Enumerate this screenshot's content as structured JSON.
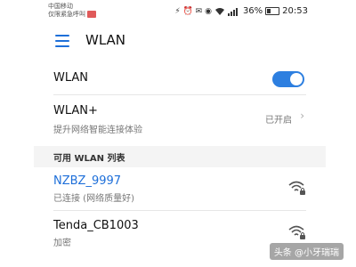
{
  "status_bar": {
    "carrier_line1": "中国移动",
    "carrier_line2": "仅限紧急呼叫",
    "signal_glyphs": "⚡ ⏰ ✉ ◉",
    "battery_percent": "36%",
    "battery_level": 0.36,
    "time": "20:53"
  },
  "app_bar": {
    "title": "WLAN"
  },
  "wlan_toggle": {
    "label": "WLAN",
    "enabled": true
  },
  "wlan_plus": {
    "label": "WLAN+",
    "description": "提升网络智能连接体验",
    "status": "已开启"
  },
  "section_header": "可用 WLAN 列表",
  "networks": [
    {
      "ssid": "NZBZ_9997",
      "status": "已连接 (网络质量好)",
      "connected": true,
      "secured": true
    },
    {
      "ssid": "Tenda_CB1003",
      "status": "加密",
      "connected": false,
      "secured": true
    }
  ],
  "watermark": "头条 @小牙瑞瑞",
  "colors": {
    "accent": "#1e6fd9",
    "toggle_on": "#2d7fe0"
  }
}
